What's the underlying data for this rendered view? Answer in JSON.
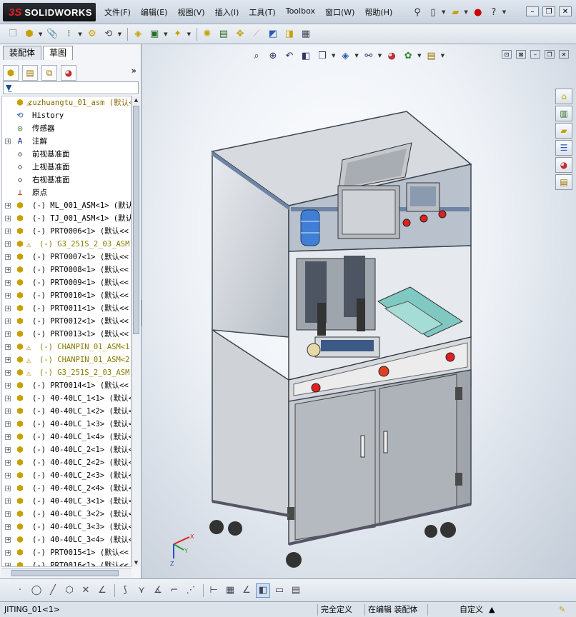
{
  "app": {
    "brand_prefix": "3S",
    "brand_name": "SOLIDWORKS"
  },
  "menus": [
    "文件(F)",
    "编辑(E)",
    "视图(V)",
    "插入(I)",
    "工具(T)",
    "Toolbox",
    "窗口(W)",
    "帮助(H)"
  ],
  "left_panel": {
    "tabs": [
      "装配体",
      "草图"
    ],
    "active_tab": "草图",
    "tree": [
      {
        "label": "zuzhuangtu_01_asm  (默认<",
        "icon": "assembly-icon",
        "warn": true,
        "kind": "root"
      },
      {
        "label": "History",
        "icon": "history-icon"
      },
      {
        "label": "传感器",
        "icon": "sensor-icon"
      },
      {
        "label": "注解",
        "icon": "annotation-icon",
        "exp": true
      },
      {
        "label": "前视基准面",
        "icon": "plane-icon"
      },
      {
        "label": "上视基准面",
        "icon": "plane-icon"
      },
      {
        "label": "右视基准面",
        "icon": "plane-icon"
      },
      {
        "label": "原点",
        "icon": "origin-icon"
      },
      {
        "label": "(-) ML_001_ASM<1> (默认",
        "icon": "assembly-icon",
        "exp": true
      },
      {
        "label": "(-) TJ_001_ASM<1> (默认",
        "icon": "assembly-icon",
        "exp": true
      },
      {
        "label": "(-) PRT0006<1> (默认<<",
        "icon": "part-icon",
        "exp": true
      },
      {
        "label": "(-) G3_251S_2_03_ASM",
        "icon": "assembly-icon",
        "exp": true,
        "warn": true,
        "kind": "yellow"
      },
      {
        "label": "(-) PRT0007<1> (默认<<",
        "icon": "part-icon",
        "exp": true
      },
      {
        "label": "(-) PRT0008<1> (默认<<",
        "icon": "part-icon",
        "exp": true
      },
      {
        "label": "(-) PRT0009<1> (默认<<",
        "icon": "part-icon",
        "exp": true
      },
      {
        "label": "(-) PRT0010<1> (默认<<",
        "icon": "part-icon",
        "exp": true
      },
      {
        "label": "(-) PRT0011<1> (默认<<",
        "icon": "part-icon",
        "exp": true
      },
      {
        "label": "(-) PRT0012<1> (默认<<",
        "icon": "part-icon",
        "exp": true
      },
      {
        "label": "(-) PRT0013<1> (默认<<",
        "icon": "part-icon",
        "exp": true
      },
      {
        "label": "(-) CHANPIN_01_ASM<1",
        "icon": "assembly-icon",
        "exp": true,
        "warn": true,
        "kind": "yellow"
      },
      {
        "label": "(-) CHANPIN_01_ASM<2",
        "icon": "assembly-icon",
        "exp": true,
        "warn": true,
        "kind": "yellow"
      },
      {
        "label": "(-) G3_251S_2_03_ASM",
        "icon": "assembly-icon",
        "exp": true,
        "warn": true,
        "kind": "yellow"
      },
      {
        "label": "(-) PRT0014<1> (默认<<",
        "icon": "part-icon",
        "exp": true
      },
      {
        "label": "(-) 40-40LC_1<1> (默认<",
        "icon": "part-icon",
        "exp": true
      },
      {
        "label": "(-) 40-40LC_1<2> (默认<",
        "icon": "part-icon",
        "exp": true
      },
      {
        "label": "(-) 40-40LC_1<3> (默认<",
        "icon": "part-icon",
        "exp": true
      },
      {
        "label": "(-) 40-40LC_1<4> (默认<",
        "icon": "part-icon",
        "exp": true
      },
      {
        "label": "(-) 40-40LC_2<1> (默认<",
        "icon": "part-icon",
        "exp": true
      },
      {
        "label": "(-) 40-40LC_2<2> (默认<",
        "icon": "part-icon",
        "exp": true
      },
      {
        "label": "(-) 40-40LC_2<3> (默认<",
        "icon": "part-icon",
        "exp": true
      },
      {
        "label": "(-) 40-40LC_2<4> (默认<",
        "icon": "part-icon",
        "exp": true
      },
      {
        "label": "(-) 40-40LC_3<1> (默认<",
        "icon": "part-icon",
        "exp": true
      },
      {
        "label": "(-) 40-40LC_3<2> (默认<",
        "icon": "part-icon",
        "exp": true
      },
      {
        "label": "(-) 40-40LC_3<3> (默认<",
        "icon": "part-icon",
        "exp": true
      },
      {
        "label": "(-) 40-40LC_3<4> (默认<",
        "icon": "part-icon",
        "exp": true
      },
      {
        "label": "(-) PRT0015<1> (默认<<",
        "icon": "part-icon",
        "exp": true
      },
      {
        "label": "(-) PRT0016<1> (默认<<",
        "icon": "part-icon",
        "exp": true
      }
    ]
  },
  "triad": {
    "x": "X",
    "y": "Y",
    "z": "Z"
  },
  "status": {
    "left": "JITING_01<1>",
    "defined": "完全定义",
    "editing": "在编辑 装配体",
    "custom": "自定义"
  }
}
